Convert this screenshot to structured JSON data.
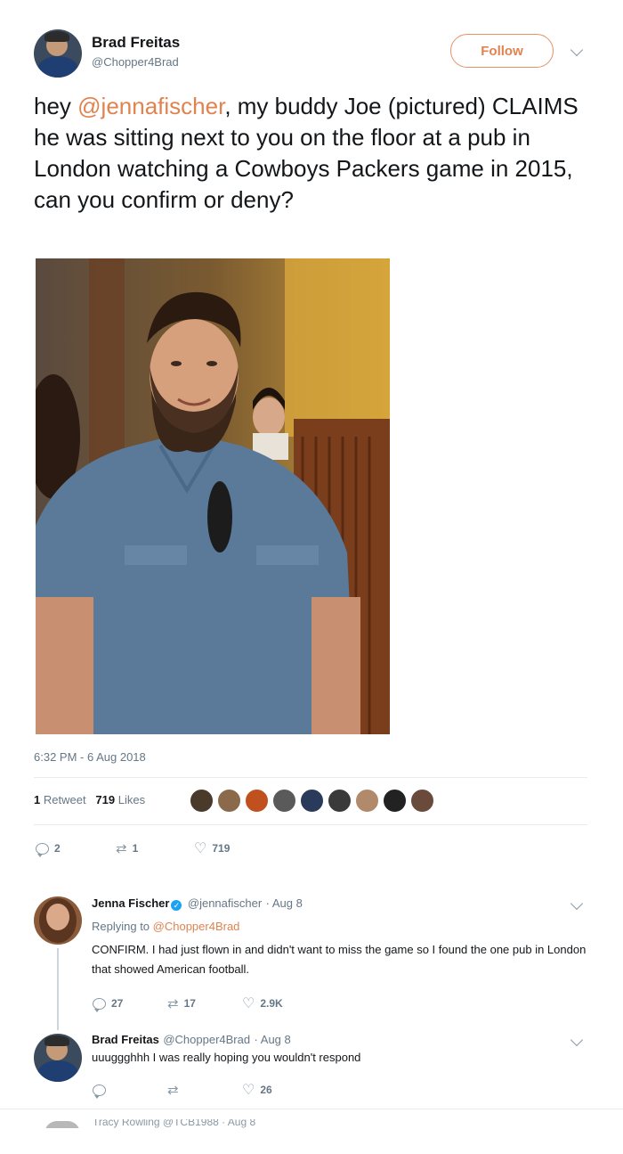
{
  "tweet": {
    "author_name": "Brad Freitas",
    "author_handle": "@Chopper4Brad",
    "follow_label": "Follow",
    "text_before_mention": "hey ",
    "mention": "@jennafischer",
    "text_after_mention": ", my buddy Joe (pictured) CLAIMS he was sitting next to you on the floor at a pub in London watching a Cowboys Packers game in 2015, can you confirm or deny?",
    "timestamp": "6:32 PM - 6 Aug 2018",
    "retweets_count": "1",
    "retweets_label": "Retweet",
    "likes_count": "719",
    "likes_label": "Likes",
    "actions": {
      "reply_count": "2",
      "retweet_count": "1",
      "like_count": "719"
    }
  },
  "replies": [
    {
      "name": "Jenna Fischer",
      "handle": "@jennafischer",
      "date": "· Aug 8",
      "replying_to_label": "Replying to ",
      "replying_to_handle": "@Chopper4Brad",
      "text": "CONFIRM. I had just flown in and didn't want to miss the game so I found the one pub in London that showed American football.",
      "reply_count": "27",
      "retweet_count": "17",
      "like_count": "2.9K"
    },
    {
      "name": "Brad Freitas",
      "handle": "@Chopper4Brad",
      "date": "· Aug 8",
      "text": "uuuggghhh I was really hoping you wouldn't respond",
      "reply_count": "",
      "retweet_count": "",
      "like_count": "26"
    }
  ],
  "next_reply_partial": "Tracy Rowling @TCB1988 · Aug 8",
  "colors": {
    "accent": "#e0834f",
    "verified": "#1da1f2",
    "muted": "#657786"
  },
  "icons": [
    "reply-icon",
    "retweet-icon",
    "heart-icon",
    "chevron-down-icon",
    "verified-badge-icon"
  ]
}
